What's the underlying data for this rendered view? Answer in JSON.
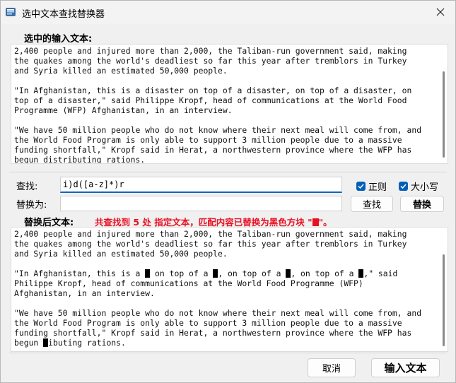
{
  "window": {
    "title": "选中文本查找替换器"
  },
  "source": {
    "label": "选中的输入文本:",
    "lines": [
      "2,400 people and injured more than 2,000, the Taliban-run government said, making",
      "the quakes among the world's deadliest so far this year after tremblors in Turkey",
      "and Syria killed an estimated 50,000 people.",
      "",
      "\"In Afghanistan, this is a disaster on top of a disaster, on top of a disaster, on",
      "top of a disaster,\" said Philippe Kropf, head of communications at the World Food",
      "Programme (WFP) Afghanistan, in an interview.",
      "",
      "\"We have 50 million people who do not know where their next meal will come from, and",
      "the World Food Program is only able to support 3 million people due to a massive",
      "funding shortfall,\" Kropf said in Herat, a northwestern province where the WFP has",
      "begun distributing rations."
    ]
  },
  "find": {
    "label": "查找:",
    "value": "i)d([a-z]*)r"
  },
  "replace": {
    "label": "替换为:",
    "value": ""
  },
  "options": {
    "regex_label": "正则",
    "regex_checked": true,
    "case_label": "大小写",
    "case_checked": true
  },
  "buttons": {
    "find": "查找",
    "replace": "替换",
    "cancel": "取消",
    "input_text": "输入文本"
  },
  "result": {
    "label": "替换后文本:",
    "status_prefix": "共查找到 5 处 指定文本，匹配内容已替换为黑色方块 \"",
    "status_suffix": "\"。",
    "status_color": "#e81123",
    "lines": [
      [
        {
          "t": "2,400 people and injured more than 2,000, the Taliban-run government said, making"
        }
      ],
      [
        {
          "t": "the quakes among the world's deadliest so far this year after tremblors in Turkey"
        }
      ],
      [
        {
          "t": "and Syria killed an estimated 50,000 people."
        }
      ],
      [
        {
          "t": ""
        }
      ],
      [
        {
          "t": "\"In Afghanistan, this is a "
        },
        {
          "m": 1
        },
        {
          "t": " on top of a "
        },
        {
          "m": 1
        },
        {
          "t": ", on top of a "
        },
        {
          "m": 1
        },
        {
          "t": ", on top of a "
        },
        {
          "m": 1
        },
        {
          "t": ",\" said"
        }
      ],
      [
        {
          "t": "Philippe Kropf, head of communications at the World Food Programme (WFP)"
        }
      ],
      [
        {
          "t": "Afghanistan, in an interview."
        }
      ],
      [
        {
          "t": ""
        }
      ],
      [
        {
          "t": "\"We have 50 million people who do not know where their next meal will come from, and"
        }
      ],
      [
        {
          "t": "the World Food Program is only able to support 3 million people due to a massive"
        }
      ],
      [
        {
          "t": "funding shortfall,\" Kropf said in Herat, a northwestern province where the WFP has"
        }
      ],
      [
        {
          "t": "begun "
        },
        {
          "m": 1
        },
        {
          "t": "ibuting rations."
        }
      ]
    ]
  }
}
